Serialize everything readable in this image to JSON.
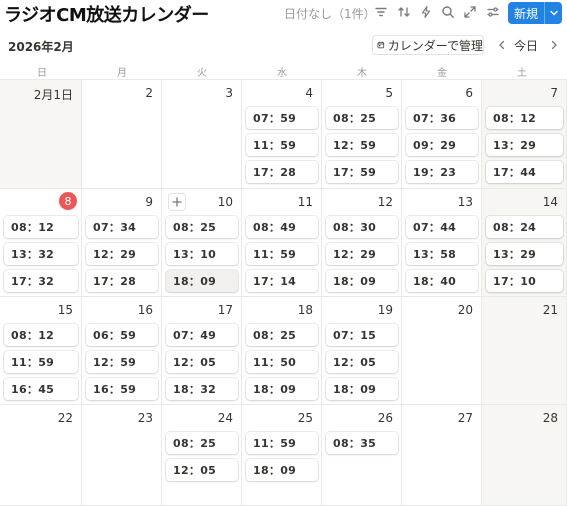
{
  "header": {
    "title": "ラジオCM放送カレンダー",
    "no_date_label": "日付なし（1件）",
    "new_button_label": "新規"
  },
  "subbar": {
    "month_label": "2026年2月",
    "manage_button_label": "カレンダーで管理",
    "today_label": "今日"
  },
  "weekdays": [
    "日",
    "月",
    "火",
    "水",
    "木",
    "金",
    "土"
  ],
  "weeks": [
    [
      {
        "day": "2月1日",
        "events": []
      },
      {
        "day": "2",
        "events": []
      },
      {
        "day": "3",
        "events": []
      },
      {
        "day": "4",
        "events": [
          "07：59",
          "11：59",
          "17：28"
        ]
      },
      {
        "day": "5",
        "events": [
          "08：25",
          "12：59",
          "17：59"
        ]
      },
      {
        "day": "6",
        "events": [
          "07：36",
          "09：29",
          "19：23"
        ]
      },
      {
        "day": "7",
        "events": [
          "08：12",
          "13：29",
          "17：44"
        ]
      }
    ],
    [
      {
        "day": "8",
        "today": true,
        "events": [
          "08：12",
          "13：32",
          "17：32"
        ]
      },
      {
        "day": "9",
        "events": [
          "07：34",
          "12：29",
          "17：28"
        ]
      },
      {
        "day": "10",
        "add_button": true,
        "events": [
          "08：25",
          "13：10",
          "18：09"
        ]
      },
      {
        "day": "11",
        "events": [
          "08：49",
          "11：59",
          "17：14"
        ]
      },
      {
        "day": "12",
        "events": [
          "08：30",
          "12：29",
          "18：09"
        ]
      },
      {
        "day": "13",
        "events": [
          "07：44",
          "13：58",
          "18：40"
        ]
      },
      {
        "day": "14",
        "events": [
          "08：24",
          "13：29",
          "17：10"
        ]
      }
    ],
    [
      {
        "day": "15",
        "events": [
          "08：12",
          "11：59",
          "16：45"
        ]
      },
      {
        "day": "16",
        "events": [
          "06：59",
          "12：59",
          "16：59"
        ]
      },
      {
        "day": "17",
        "events": [
          "07：49",
          "12：05",
          "18：32"
        ]
      },
      {
        "day": "18",
        "events": [
          "08：25",
          "11：50",
          "18：09"
        ]
      },
      {
        "day": "19",
        "events": [
          "07：15",
          "12：05",
          "18：09"
        ]
      },
      {
        "day": "20",
        "events": []
      },
      {
        "day": "21",
        "events": []
      }
    ],
    [
      {
        "day": "22",
        "events": []
      },
      {
        "day": "23",
        "events": []
      },
      {
        "day": "24",
        "events": [
          "08：25",
          "12：05"
        ]
      },
      {
        "day": "25",
        "events": [
          "11：59",
          "18：09"
        ]
      },
      {
        "day": "26",
        "events": [
          "08：35"
        ]
      },
      {
        "day": "27",
        "events": []
      },
      {
        "day": "28",
        "events": []
      }
    ]
  ],
  "icons": {
    "filter": "filter-icon",
    "sort": "sort-icon",
    "automation": "lightning-icon",
    "search": "search-icon",
    "expand": "expand-icon",
    "settings": "sliders-icon"
  },
  "colors": {
    "accent": "#2383e2",
    "today": "#eb5757",
    "weekend_bg": "#f7f6f3"
  }
}
